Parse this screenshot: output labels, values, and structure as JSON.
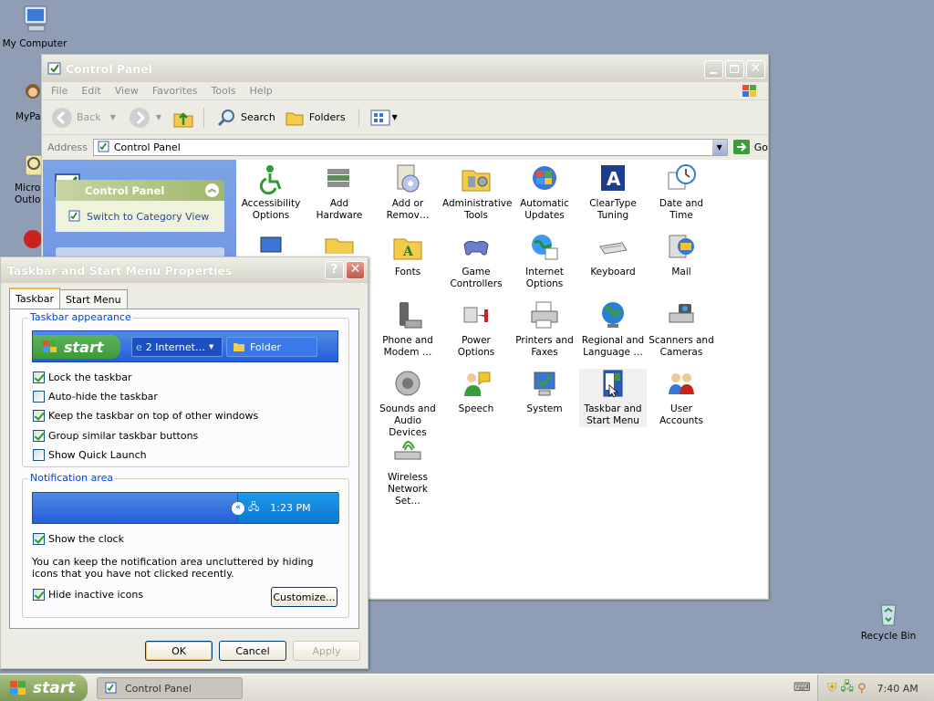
{
  "desktop": {
    "icons": [
      {
        "label": "My Computer"
      },
      {
        "label": "MyPa"
      },
      {
        "label": "Micros Outlo"
      },
      {
        "label": "Recycle Bin"
      }
    ]
  },
  "control_panel": {
    "title": "Control Panel",
    "menu": [
      "File",
      "Edit",
      "View",
      "Favorites",
      "Tools",
      "Help"
    ],
    "toolbar": {
      "back": "Back",
      "search": "Search",
      "folders": "Folders"
    },
    "address": {
      "label": "Address",
      "value": "Control Panel",
      "go": "Go"
    },
    "sidebar": {
      "heading": "Control Panel",
      "link": "Switch to Category View"
    },
    "items": [
      {
        "label": "Accessibility Options",
        "icon": "accessibility-icon"
      },
      {
        "label": "Add Hardware",
        "icon": "add-hardware-icon"
      },
      {
        "label": "Add or Remov…",
        "icon": "add-remove-programs-icon"
      },
      {
        "label": "Administrative Tools",
        "icon": "administrative-tools-icon"
      },
      {
        "label": "Automatic Updates",
        "icon": "automatic-updates-icon"
      },
      {
        "label": "ClearType Tuning",
        "icon": "cleartype-icon"
      },
      {
        "label": "Date and Time",
        "icon": "date-time-icon"
      },
      {
        "label": "Fonts",
        "icon": "fonts-icon"
      },
      {
        "label": "Game Controllers",
        "icon": "game-controllers-icon"
      },
      {
        "label": "Internet Options",
        "icon": "internet-options-icon"
      },
      {
        "label": "Keyboard",
        "icon": "keyboard-icon"
      },
      {
        "label": "Mail",
        "icon": "mail-icon"
      },
      {
        "label": "Phone and Modem …",
        "icon": "phone-modem-icon"
      },
      {
        "label": "Power Options",
        "icon": "power-options-icon"
      },
      {
        "label": "Printers and Faxes",
        "icon": "printers-icon"
      },
      {
        "label": "Regional and Language …",
        "icon": "regional-icon"
      },
      {
        "label": "Scanners and Cameras",
        "icon": "scanners-icon"
      },
      {
        "label": "Sounds and Audio Devices",
        "icon": "sounds-icon"
      },
      {
        "label": "Speech",
        "icon": "speech-icon"
      },
      {
        "label": "System",
        "icon": "system-icon"
      },
      {
        "label": "Taskbar and Start Menu",
        "icon": "taskbar-icon"
      },
      {
        "label": "User Accounts",
        "icon": "user-accounts-icon"
      },
      {
        "label": "Wireless Network Set…",
        "icon": "wireless-icon"
      }
    ]
  },
  "dialog": {
    "title": "Taskbar and Start Menu Properties",
    "tabs": [
      "Taskbar",
      "Start Menu"
    ],
    "appearance": {
      "legend": "Taskbar appearance",
      "preview_start": "start",
      "preview_item1": "2 Internet…",
      "preview_item2": "Folder",
      "options": [
        {
          "label": "Lock the taskbar",
          "checked": true
        },
        {
          "label": "Auto-hide the taskbar",
          "checked": false
        },
        {
          "label": "Keep the taskbar on top of other windows",
          "checked": true
        },
        {
          "label": "Group similar taskbar buttons",
          "checked": true
        },
        {
          "label": "Show Quick Launch",
          "checked": false
        }
      ]
    },
    "notification": {
      "legend": "Notification area",
      "preview_time": "1:23 PM",
      "show_clock": {
        "label": "Show the clock",
        "checked": true
      },
      "info": "You can keep the notification area uncluttered by hiding icons that you have not clicked recently.",
      "hide_inactive": {
        "label": "Hide inactive icons",
        "checked": true
      },
      "customize": "Customize..."
    },
    "buttons": {
      "ok": "OK",
      "cancel": "Cancel",
      "apply": "Apply"
    }
  },
  "taskbar": {
    "start": "start",
    "window_item": "Control Panel",
    "clock": "7:40 AM"
  }
}
